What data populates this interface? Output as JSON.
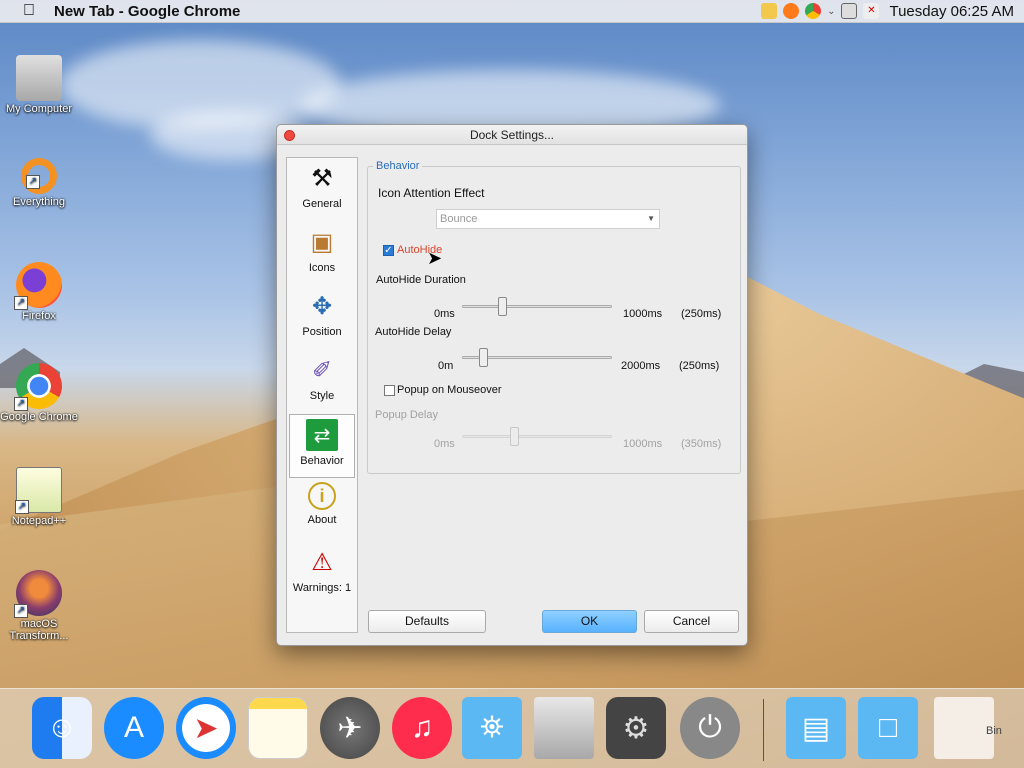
{
  "menubar": {
    "apple": "",
    "app_title": "New Tab - Google Chrome",
    "clock": "Tuesday 06:25 AM",
    "tray_icons": [
      "folder-icon",
      "firefox-icon",
      "chrome-icon",
      "chevron-down-icon",
      "network-icon",
      "volume-mute-icon"
    ]
  },
  "desktop": {
    "icons": [
      {
        "label": "My Computer",
        "icon": "computer-icon"
      },
      {
        "label": "Everything",
        "icon": "search-icon"
      },
      {
        "label": "Firefox",
        "icon": "firefox-icon"
      },
      {
        "label": "Google Chrome",
        "icon": "chrome-icon"
      },
      {
        "label": "Notepad++",
        "icon": "notepad-icon"
      },
      {
        "label": "macOS Transform...",
        "icon": "macos-icon"
      }
    ]
  },
  "dialog": {
    "title": "Dock Settings...",
    "sidebar": [
      {
        "label": "General",
        "icon": "tools-icon"
      },
      {
        "label": "Icons",
        "icon": "box-icon"
      },
      {
        "label": "Position",
        "icon": "arrows-icon"
      },
      {
        "label": "Style",
        "icon": "brush-icon"
      },
      {
        "label": "Behavior",
        "icon": "swap-arrows-icon"
      },
      {
        "label": "About",
        "icon": "info-icon"
      },
      {
        "label": "Warnings: 1",
        "icon": "warning-icon"
      }
    ],
    "active_tab": "Behavior",
    "group_title": "Behavior",
    "attention_label": "Icon Attention Effect",
    "attention_value": "Bounce",
    "autohide_label": "AutoHide",
    "autohide_checked": true,
    "duration": {
      "label": "AutoHide Duration",
      "min": "0ms",
      "max": "1000ms",
      "value": "(250ms)",
      "level": 0.25
    },
    "delay": {
      "label": "AutoHide Delay",
      "min": "0m",
      "max": "2000ms",
      "value": "(250ms)",
      "level": 0.125
    },
    "popup_label": "Popup on Mouseover",
    "popup_checked": false,
    "popup_delay": {
      "label": "Popup Delay",
      "min": "0ms",
      "max": "1000ms",
      "value": "(350ms)",
      "level": 0.35
    },
    "buttons": {
      "defaults": "Defaults",
      "ok": "OK",
      "cancel": "Cancel"
    }
  },
  "dock": {
    "items": [
      "finder-icon",
      "app-store-icon",
      "safari-icon",
      "notes-icon",
      "launchpad-icon",
      "music-icon",
      "applications-folder-icon",
      "computer-icon",
      "settings-icon",
      "power-icon",
      "documents-folder-icon",
      "downloads-folder-icon",
      "trash-icon"
    ],
    "trash_label": "Bin"
  },
  "colors": {
    "accent": "#2a6db5",
    "ok_button": "#58b2ff",
    "close": "#ee4a3f",
    "autohide_text": "#d9452c"
  }
}
